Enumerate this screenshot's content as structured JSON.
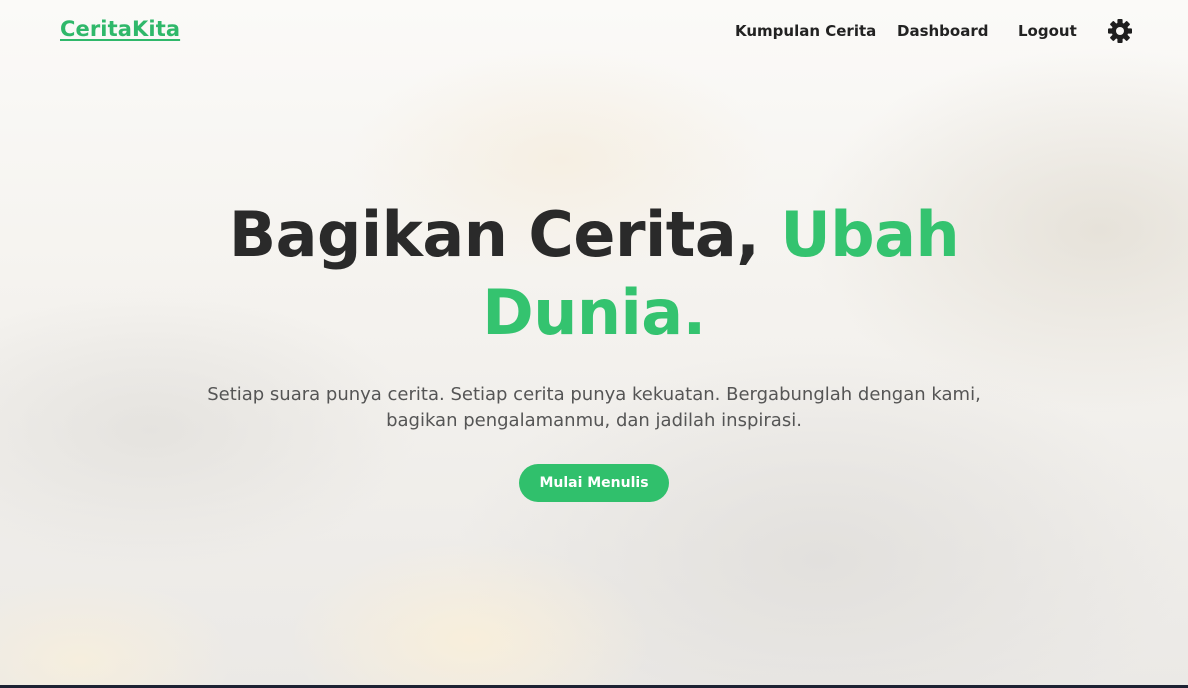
{
  "nav": {
    "brand": "CeritaKita",
    "links": [
      "Kumpulan Cerita",
      "Dashboard",
      "Logout"
    ],
    "theme_icon": "gear-icon"
  },
  "hero": {
    "headline_main": "Bagikan Cerita, ",
    "headline_accent": "Ubah Dunia.",
    "subtitle": "Setiap suara punya cerita. Setiap cerita punya kekuatan. Bergabunglah dengan kami, bagikan pengalamanmu, dan jadilah inspirasi.",
    "cta_label": "Mulai Menulis"
  },
  "colors": {
    "accent": "#34c36f",
    "button": "#30c06c",
    "text_dark": "#2a2a2a"
  }
}
